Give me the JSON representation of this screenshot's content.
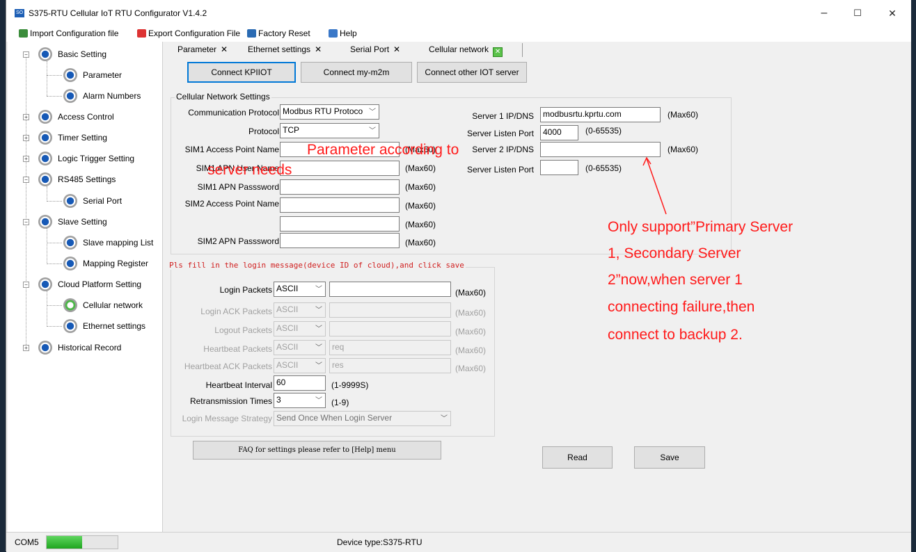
{
  "window": {
    "title": "S375-RTU Cellular IoT RTU Configurator V1.4.2",
    "logo_text": "SO",
    "min": "–",
    "max": "☐",
    "close": "✕"
  },
  "menu": {
    "import": "Import Configuration file",
    "export": "Export Configuration File",
    "reset": "Factory Reset",
    "help": "Help"
  },
  "tree": {
    "basic": "Basic Setting",
    "parameter": "Parameter",
    "alarm": "Alarm Numbers",
    "access": "Access Control",
    "timer": "Timer Setting",
    "logic": "Logic Trigger Setting",
    "rs485": "RS485 Settings",
    "serial": "Serial Port",
    "slave": "Slave Setting",
    "slave_map": "Slave mapping List",
    "map_reg": "Mapping Register",
    "cloud": "Cloud Platform Setting",
    "cellular": "Cellular network",
    "ethernet": "Ethernet settings",
    "history": "Historical Record"
  },
  "tabs": {
    "t1": "Parameter",
    "t2": "Ethernet settings",
    "t3": "Serial Port",
    "t4": "Cellular network",
    "x": "✕"
  },
  "top_buttons": {
    "kpiiot": "Connect KPIIOT",
    "m2m": "Connect my-m2m",
    "other": "Connect other IOT server"
  },
  "cellular": {
    "group": "Cellular Network Settings",
    "comm_label": "Communication Protocol",
    "comm_value": "Modbus RTU Protoco",
    "proto_label": "Protocol",
    "proto_value": "TCP",
    "sim1_apn_label": "SIM1 Access Point Name",
    "sim1_user_label": "SIM1 APN User Name",
    "sim1_pass_label": "SIM1 APN Passsword",
    "sim2_apn_label": "SIM2 Access Point Name",
    "sim2_pass_label": "SIM2 APN Passsword",
    "max60": "(Max60)",
    "s1_label": "Server 1 IP/DNS",
    "s1_value": "modbusrtu.kprtu.com",
    "s1_port_label": "Server Listen Port",
    "s1_port_value": "4000",
    "port_range": "(0-65535)",
    "s2_label": "Server 2 IP/DNS",
    "s2_port_label": "Server Listen Port"
  },
  "login": {
    "group": "Pls fill in the login message(device ID of cloud),and click save",
    "login_label": "Login Packets",
    "login_ack_label": "Login ACK Packets",
    "logout_label": "Logout Packets",
    "hb_label": "Heartbeat Packets",
    "hb_ack_label": "Heartbeat ACK Packets",
    "ascii": "ASCII",
    "hb_value": "req",
    "hb_ack_value": "res",
    "max60": "(Max60)",
    "interval_label": "Heartbeat Interval",
    "interval_value": "60",
    "interval_range": "(1-9999S)",
    "retrans_label": "Retransmission Times",
    "retrans_value": "3",
    "retrans_range": "(1-9)",
    "strategy_label": "Login Message Strategy",
    "strategy_value": "Send Once When Login Server"
  },
  "faq_button": "FAQ for settings please refer to [Help] menu",
  "read_button": "Read",
  "save_button": "Save",
  "annotations": {
    "param_line1": "Parameter according to",
    "param_line2": "server needs",
    "server_line1": "Only support”Primary Server",
    "server_line2": "1, Secondary Server",
    "server_line3": "2”now,when server 1",
    "server_line4": "connecting failure,then",
    "server_line5": "connect to backup 2."
  },
  "status": {
    "port": "COM5",
    "progress": 0.5,
    "device": "Device type:S375-RTU"
  }
}
